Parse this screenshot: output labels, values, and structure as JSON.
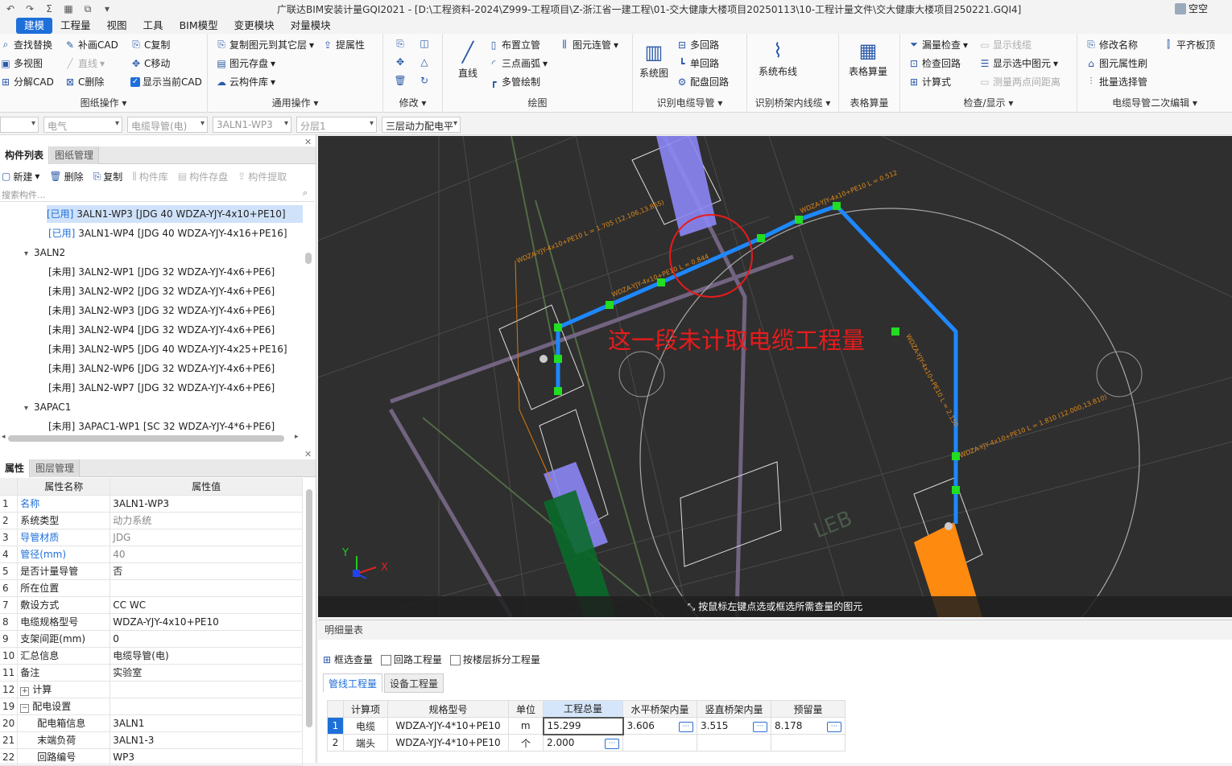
{
  "window": {
    "title": "广联达BIM安装计量GQI2021 - [D:\\工程资料-2024\\Z999-工程项目\\Z-浙江省一建工程\\01-交大健康大楼项目20250113\\10-工程计量文件\\交大健康大楼项目250221.GQI4]",
    "user": "空空"
  },
  "menu": [
    "建模",
    "工程量",
    "视图",
    "工具",
    "BIM模型",
    "变更模块",
    "对量模块"
  ],
  "ribbon": {
    "drawing_ops": {
      "label": "图纸操作",
      "items": [
        "查找替换",
        "补画CAD",
        "C复制",
        "多视图",
        "直线",
        "C移动",
        "分解CAD",
        "C删除",
        "显示当前CAD"
      ]
    },
    "common_ops": {
      "label": "通用操作",
      "items": [
        "复制图元到其它层",
        "提属性",
        "图元存盘",
        "云构件库"
      ]
    },
    "modify": {
      "label": "修改"
    },
    "draw": {
      "label": "绘图",
      "big": "直线",
      "items": [
        "布置立管",
        "图元连管",
        "三点画弧",
        "多管绘制"
      ]
    },
    "identify_cable": {
      "label": "识别电缆导管",
      "big": "系统图",
      "items": [
        "多回路",
        "单回路",
        "配盘回路"
      ]
    },
    "identify_tray": {
      "label": "识别桥架内线缆",
      "big": "系统布线"
    },
    "table_calc": {
      "label": "表格算量",
      "big": "表格算量"
    },
    "check": {
      "label": "检查/显示",
      "items": [
        "漏量检查",
        "显示线缆",
        "检查回路",
        "显示选中图元",
        "计算式",
        "测量两点间距离"
      ]
    },
    "cable_edit": {
      "label": "电缆导管二次编辑",
      "items": [
        "修改名称",
        "平齐板顶",
        "图元属性刷",
        "批量选择管"
      ]
    }
  },
  "filters": [
    "电气",
    "电缆导管(电)",
    "3ALN1-WP3",
    "分层1",
    "三层动力配电平"
  ],
  "component_panel": {
    "tabs": [
      "构件列表",
      "图纸管理"
    ],
    "toolbar": [
      "新建",
      "删除",
      "复制",
      "构件库",
      "构件存盘",
      "构件提取"
    ],
    "search_placeholder": "搜索构件...",
    "rows": [
      {
        "tag": "[已用]",
        "text": "3ALN1-WP3 [JDG 40 WDZA-YJY-4x10+PE10]"
      },
      {
        "tag": "[已用]",
        "text": "3ALN1-WP4 [JDG 40 WDZA-YJY-4x16+PE16]"
      },
      {
        "group": "3ALN2"
      },
      {
        "tag": "[未用]",
        "text": "3ALN2-WP1 [JDG 32 WDZA-YJY-4x6+PE6]"
      },
      {
        "tag": "[未用]",
        "text": "3ALN2-WP2 [JDG 32 WDZA-YJY-4x6+PE6]"
      },
      {
        "tag": "[未用]",
        "text": "3ALN2-WP3 [JDG 32 WDZA-YJY-4x6+PE6]"
      },
      {
        "tag": "[未用]",
        "text": "3ALN2-WP4 [JDG 32 WDZA-YJY-4x6+PE6]"
      },
      {
        "tag": "[未用]",
        "text": "3ALN2-WP5 [JDG 40 WDZA-YJY-4x25+PE16]"
      },
      {
        "tag": "[未用]",
        "text": "3ALN2-WP6 [JDG 32 WDZA-YJY-4x6+PE6]"
      },
      {
        "tag": "[未用]",
        "text": "3ALN2-WP7 [JDG 32 WDZA-YJY-4x6+PE6]"
      },
      {
        "group": "3APAC1"
      },
      {
        "tag": "[未用]",
        "text": "3APAC1-WP1 [SC 32 WDZA-YJY-4*6+PE6]"
      }
    ]
  },
  "property_panel": {
    "tabs": [
      "属性",
      "图层管理"
    ],
    "headers": [
      "属性名称",
      "属性值"
    ],
    "rows": [
      {
        "n": "1",
        "name": "名称",
        "value": "3ALN1-WP3",
        "blue": true
      },
      {
        "n": "2",
        "name": "系统类型",
        "value": "动力系统",
        "gray": true
      },
      {
        "n": "3",
        "name": "导管材质",
        "value": "JDG",
        "blue": true,
        "gray": true
      },
      {
        "n": "4",
        "name": "管径(mm)",
        "value": "40",
        "blue": true,
        "gray": true
      },
      {
        "n": "5",
        "name": "是否计量导管",
        "value": "否"
      },
      {
        "n": "6",
        "name": "所在位置",
        "value": ""
      },
      {
        "n": "7",
        "name": "敷设方式",
        "value": "CC WC"
      },
      {
        "n": "8",
        "name": "电缆规格型号",
        "value": "WDZA-YJY-4x10+PE10"
      },
      {
        "n": "9",
        "name": "支架间距(mm)",
        "value": "0"
      },
      {
        "n": "10",
        "name": "汇总信息",
        "value": "电缆导管(电)"
      },
      {
        "n": "11",
        "name": "备注",
        "value": "实验室"
      },
      {
        "n": "12",
        "name": "计算",
        "value": "",
        "expand": "+"
      },
      {
        "n": "19",
        "name": "配电设置",
        "value": "",
        "expand": "−"
      },
      {
        "n": "20",
        "name": "配电箱信息",
        "value": "3ALN1",
        "indent": true
      },
      {
        "n": "21",
        "name": "末端负荷",
        "value": "3ALN1-3",
        "indent": true
      },
      {
        "n": "22",
        "name": "回路编号",
        "value": "WP3",
        "indent": true
      }
    ]
  },
  "viewport": {
    "annotation": "这一段未计取电缆工程量",
    "status": "按鼠标左键点选或框选所需查量的图元",
    "labels": [
      "WDZA-YJY-4x10+PE10 L = 1.705 (12.106,13.865)",
      "WDZA-YJY-4x10+PE10 L = 0.844",
      "WDZA-YJY-4x10+PE10 L = 0.512",
      "WDZA-YJY-4x10+PE10 L = 2.150",
      "WDZA-YJY-4x10+PE10 L = 1.810 (12.000,13.810)"
    ],
    "axis": {
      "x": "X",
      "y": "Y"
    },
    "bg_text": "LEB"
  },
  "detail_panel": {
    "title": "明细量表",
    "toolbar": [
      "框选查量",
      "回路工程量",
      "按楼层拆分工程量"
    ],
    "tabs": [
      "管线工程量",
      "设备工程量"
    ],
    "headers": [
      "计算项",
      "规格型号",
      "单位",
      "工程总量",
      "水平桥架内量",
      "竖直桥架内量",
      "预留量"
    ],
    "rows": [
      {
        "idx": "1",
        "item": "电缆",
        "spec": "WDZA-YJY-4*10+PE10",
        "unit": "m",
        "total": "15.299",
        "h": "3.606",
        "v": "3.515",
        "r": "8.178"
      },
      {
        "idx": "2",
        "item": "端头",
        "spec": "WDZA-YJY-4*10+PE10",
        "unit": "个",
        "total": "2.000",
        "h": "",
        "v": "",
        "r": ""
      }
    ]
  },
  "colors": {
    "accent": "#1e6fd9",
    "pipe": "#1e88ff",
    "node": "#22dd22",
    "annotation": "#e81b1b",
    "label": "#e08a1a"
  }
}
